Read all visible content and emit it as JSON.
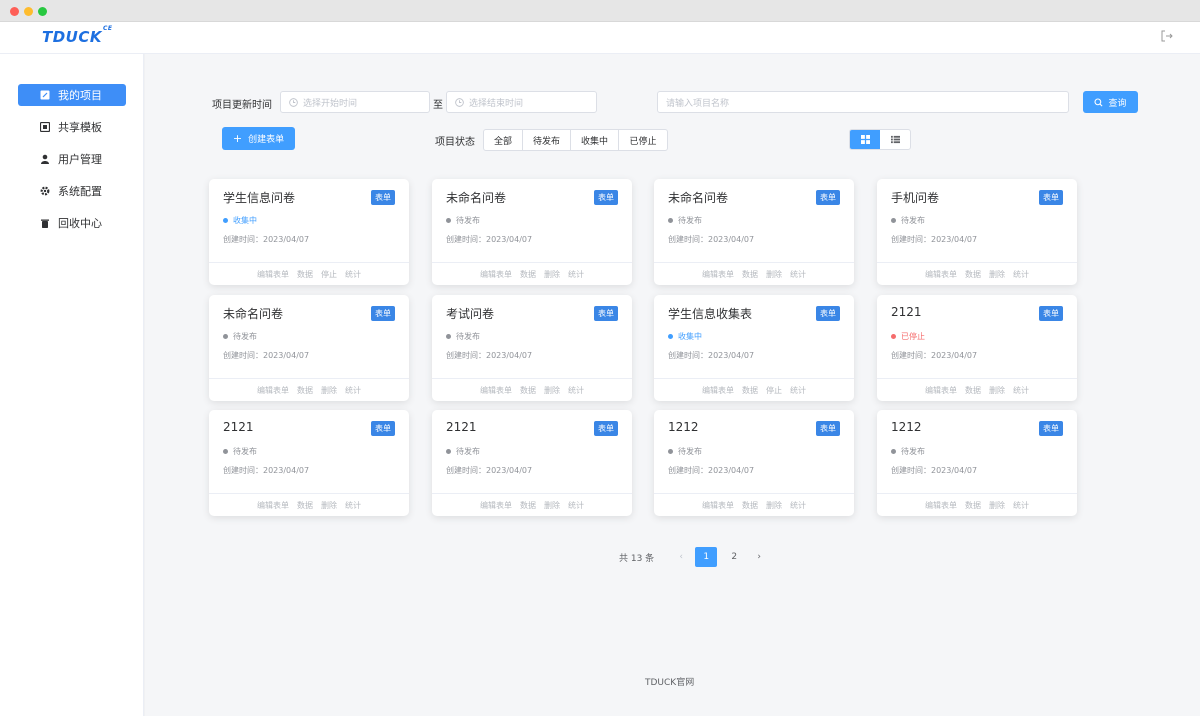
{
  "app": {
    "logo": "TDUCK",
    "logo_sup": "CE"
  },
  "sidebar": {
    "items": [
      {
        "label": "我的项目",
        "icon": "edit-icon",
        "active": true
      },
      {
        "label": "共享模板",
        "icon": "template-icon",
        "active": false
      },
      {
        "label": "用户管理",
        "icon": "user-icon",
        "active": false
      },
      {
        "label": "系统配置",
        "icon": "gear-icon",
        "active": false
      },
      {
        "label": "回收中心",
        "icon": "trash-icon",
        "active": false
      }
    ]
  },
  "filters": {
    "update_time_label": "项目更新时间",
    "start_placeholder": "选择开始时间",
    "to_label": "至",
    "end_placeholder": "选择结束时间",
    "name_placeholder": "请输入项目名称",
    "query_button": "查询",
    "create_button": "创建表单",
    "status_label": "项目状态",
    "status_options": [
      "全部",
      "待发布",
      "收集中",
      "已停止"
    ]
  },
  "cards": [
    {
      "title": "学生信息问卷",
      "tag": "表单",
      "status": "收集中",
      "status_color": "#409eff",
      "date": "创建时间：2023/04/07",
      "actions": [
        "编辑表单",
        "数据",
        "停止",
        "统计"
      ]
    },
    {
      "title": "未命名问卷",
      "tag": "表单",
      "status": "待发布",
      "status_color": "#909399",
      "date": "创建时间：2023/04/07",
      "actions": [
        "编辑表单",
        "数据",
        "删除",
        "统计"
      ]
    },
    {
      "title": "未命名问卷",
      "tag": "表单",
      "status": "待发布",
      "status_color": "#909399",
      "date": "创建时间：2023/04/07",
      "actions": [
        "编辑表单",
        "数据",
        "删除",
        "统计"
      ]
    },
    {
      "title": "手机问卷",
      "tag": "表单",
      "status": "待发布",
      "status_color": "#909399",
      "date": "创建时间：2023/04/07",
      "actions": [
        "编辑表单",
        "数据",
        "删除",
        "统计"
      ]
    },
    {
      "title": "未命名问卷",
      "tag": "表单",
      "status": "待发布",
      "status_color": "#909399",
      "date": "创建时间：2023/04/07",
      "actions": [
        "编辑表单",
        "数据",
        "删除",
        "统计"
      ]
    },
    {
      "title": "考试问卷",
      "tag": "表单",
      "status": "待发布",
      "status_color": "#909399",
      "date": "创建时间：2023/04/07",
      "actions": [
        "编辑表单",
        "数据",
        "删除",
        "统计"
      ]
    },
    {
      "title": "学生信息收集表",
      "tag": "表单",
      "status": "收集中",
      "status_color": "#409eff",
      "date": "创建时间：2023/04/07",
      "actions": [
        "编辑表单",
        "数据",
        "停止",
        "统计"
      ]
    },
    {
      "title": "2121",
      "tag": "表单",
      "status": "已停止",
      "status_color": "#f56c6c",
      "date": "创建时间：2023/04/07",
      "actions": [
        "编辑表单",
        "数据",
        "删除",
        "统计"
      ]
    },
    {
      "title": "2121",
      "tag": "表单",
      "status": "待发布",
      "status_color": "#909399",
      "date": "创建时间：2023/04/07",
      "actions": [
        "编辑表单",
        "数据",
        "删除",
        "统计"
      ]
    },
    {
      "title": "2121",
      "tag": "表单",
      "status": "待发布",
      "status_color": "#909399",
      "date": "创建时间：2023/04/07",
      "actions": [
        "编辑表单",
        "数据",
        "删除",
        "统计"
      ]
    },
    {
      "title": "1212",
      "tag": "表单",
      "status": "待发布",
      "status_color": "#909399",
      "date": "创建时间：2023/04/07",
      "actions": [
        "编辑表单",
        "数据",
        "删除",
        "统计"
      ]
    },
    {
      "title": "1212",
      "tag": "表单",
      "status": "待发布",
      "status_color": "#909399",
      "date": "创建时间：2023/04/07",
      "actions": [
        "编辑表单",
        "数据",
        "删除",
        "统计"
      ]
    }
  ],
  "pagination": {
    "total": "共 13 条",
    "pages": [
      "1",
      "2"
    ],
    "current": "1",
    "prev": "‹",
    "next": "›"
  },
  "footer": {
    "link": "TDUCK官网"
  },
  "colors": {
    "primary": "#409eff",
    "active_nav": "#3e8ef7",
    "tag": "#3a86e6"
  }
}
